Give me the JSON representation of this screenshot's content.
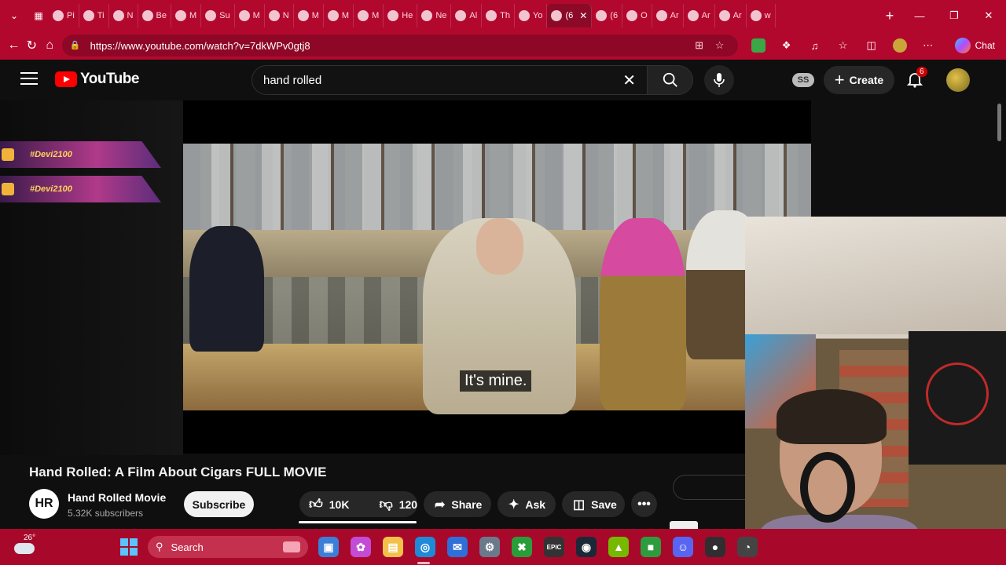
{
  "browser": {
    "tabs": [
      {
        "label": "Pi"
      },
      {
        "label": "Ti"
      },
      {
        "label": "N"
      },
      {
        "label": "Be"
      },
      {
        "label": "M"
      },
      {
        "label": "Su"
      },
      {
        "label": "M"
      },
      {
        "label": "N"
      },
      {
        "label": "M"
      },
      {
        "label": "M"
      },
      {
        "label": "M"
      },
      {
        "label": "He"
      },
      {
        "label": "Ne"
      },
      {
        "label": "Al"
      },
      {
        "label": "Th"
      },
      {
        "label": "Yo"
      },
      {
        "label": "(6"
      },
      {
        "label": "(6"
      },
      {
        "label": "O"
      },
      {
        "label": "Ar"
      },
      {
        "label": "Ar"
      },
      {
        "label": "Ar"
      },
      {
        "label": "w"
      }
    ],
    "active_tab_index": 16,
    "url": "https://www.youtube.com/watch?v=7dkWPv0gtj8",
    "chat_label": "Chat",
    "accent_color": "#b3082e"
  },
  "youtube": {
    "logo_text": "YouTube",
    "search_value": "hand rolled",
    "account_badge": "SS",
    "create_label": "Create",
    "notification_count": "6"
  },
  "overlay": {
    "banner_top": "#Devi2100",
    "banner_bottom": "#Devi2100"
  },
  "player": {
    "caption": "It's mine."
  },
  "video": {
    "title": "Hand Rolled: A Film About Cigars FULL MOVIE",
    "channel_initials": "HR",
    "channel_name": "Hand Rolled Movie",
    "subscribers": "5.32K subscribers",
    "subscribe_label": "Subscribe",
    "likes": "10K",
    "dislikes": "120",
    "share_label": "Share",
    "ask_label": "Ask",
    "save_label": "Save",
    "more_label": "•••"
  },
  "taskbar": {
    "temperature": "26°",
    "search_label": "Search",
    "apps": [
      {
        "icon": "explorer-window-icon"
      },
      {
        "icon": "copilot-icon"
      },
      {
        "icon": "file-explorer-icon"
      },
      {
        "icon": "edge-icon"
      },
      {
        "icon": "outlook-icon"
      },
      {
        "icon": "settings-icon"
      },
      {
        "icon": "xbox-icon"
      },
      {
        "icon": "epic-games-icon"
      },
      {
        "icon": "steam-icon"
      },
      {
        "icon": "nvidia-icon"
      },
      {
        "icon": "app-icon"
      },
      {
        "icon": "discord-icon"
      },
      {
        "icon": "obs-icon"
      },
      {
        "icon": "speedometer-icon"
      }
    ]
  }
}
